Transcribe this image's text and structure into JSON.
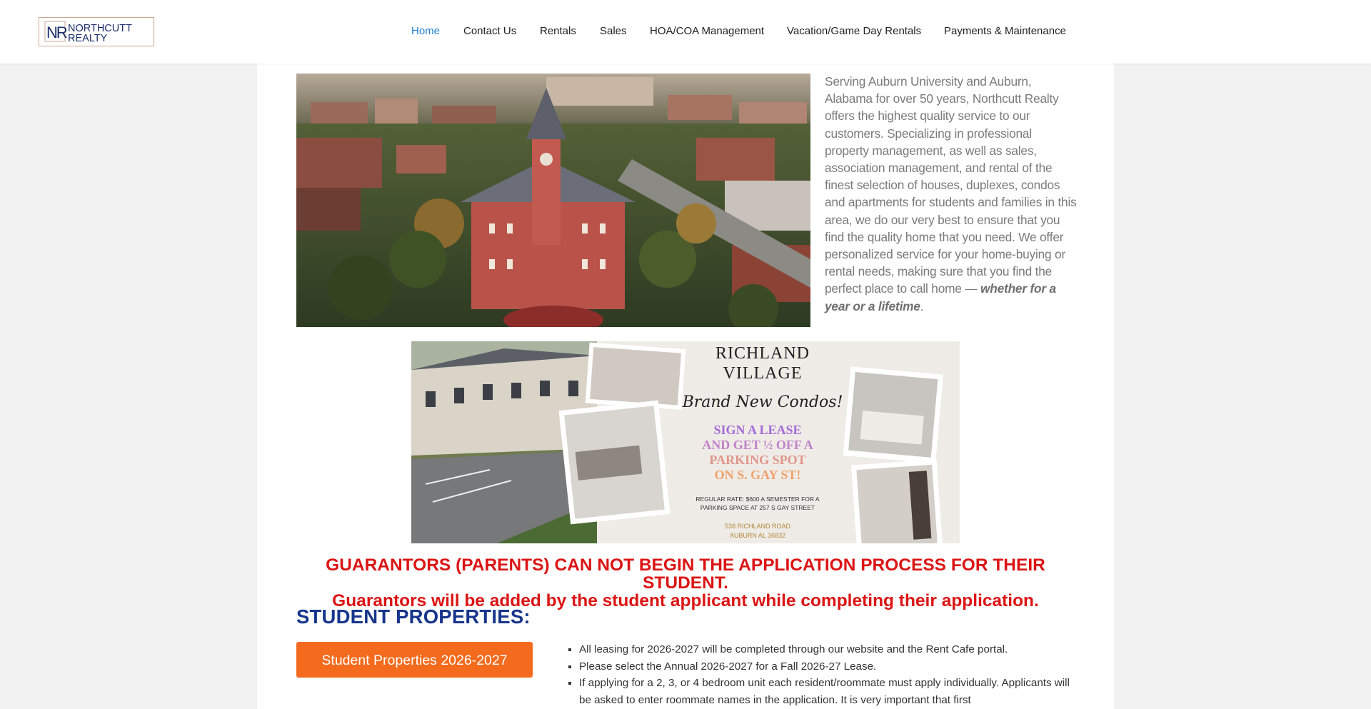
{
  "header": {
    "logo": {
      "initials": "NR",
      "line1": "NORTHCUTT",
      "line2": "REALTY"
    },
    "nav": [
      {
        "label": "Home",
        "active": true
      },
      {
        "label": "Contact Us"
      },
      {
        "label": "Rentals"
      },
      {
        "label": "Sales"
      },
      {
        "label": "HOA/COA Management"
      },
      {
        "label": "Vacation/Game Day Rentals"
      },
      {
        "label": "Payments & Maintenance"
      }
    ]
  },
  "intro": {
    "text": "Serving Auburn University and Auburn, Alabama for over 50 years, Northcutt Realty offers the highest quality service to our customers. Specializing in professional property management, as well as sales, association management, and rental of the finest selection of houses, duplexes, condos and apartments for students and families in this area, we do our very best to ensure that you find the quality home that you need. We offer personalized service for your home-buying or rental needs, making sure that you find the perfect place to call home — ",
    "emphasis": "whether for a year or a lifetime",
    "end": "."
  },
  "promo": {
    "title_line1": "RICHLAND",
    "title_line2": "VILLAGE",
    "script": "Brand New Condos!",
    "offer_lines": [
      "SIGN A LEASE",
      "AND GET ½ OFF A",
      "PARKING SPOT",
      "ON S. GAY ST!"
    ],
    "fine_print_1": "REGULAR RATE: $600 A SEMESTER FOR A",
    "fine_print_2": "PARKING SPACE AT 257 S GAY STREET",
    "address_1": "538 RICHLAND ROAD",
    "address_2": "AUBURN AL 36832"
  },
  "notice": {
    "line1": "GUARANTORS (PARENTS) CAN NOT BEGIN THE APPLICATION PROCESS FOR THEIR STUDENT.",
    "line2": "Guarantors will be added by the student applicant while completing their application."
  },
  "student": {
    "title": "STUDENT PROPERTIES:",
    "button": "Student Properties 2026-2027",
    "bullets": [
      "All leasing for 2026-2027 will be completed through our website and the Rent Cafe portal.",
      "Please select the Annual 2026-2027 for a Fall 2026-27 Lease.",
      "If applying for a 2, 3, or 4 bedroom unit each resident/roommate must apply individually. Applicants will be asked to enter roommate names in the application. It is very important that first"
    ]
  },
  "colors": {
    "nav_active": "#1f7fd1",
    "notice_red": "#dc1414",
    "title_navy": "#17358c",
    "cta_orange": "#f46b1d"
  },
  "icons": {
    "logo": "nr-monogram-logo"
  }
}
